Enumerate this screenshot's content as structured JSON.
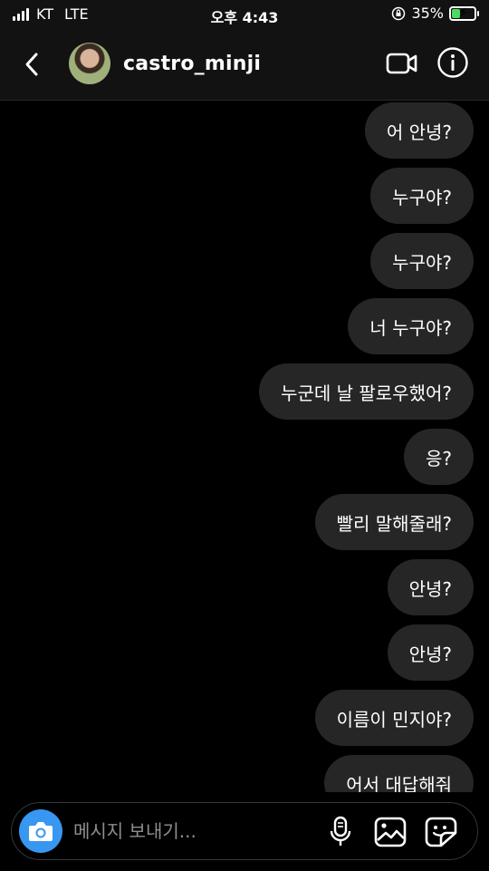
{
  "status_bar": {
    "carrier": "KT",
    "network": "LTE",
    "time": "오후 4:43",
    "battery_percent": "35%",
    "battery_level": 0.35,
    "battery_color": "#4cd964"
  },
  "header": {
    "username": "castro_minji",
    "back_icon": "chevron-left-icon",
    "video_icon": "video-camera-icon",
    "info_icon": "info-icon"
  },
  "messages": [
    {
      "text": "어 안녕?"
    },
    {
      "text": "누구야?"
    },
    {
      "text": "누구야?"
    },
    {
      "text": "너 누구야?"
    },
    {
      "text": "누군데 날 팔로우했어?"
    },
    {
      "text": "응?"
    },
    {
      "text": "빨리 말해줄래?"
    },
    {
      "text": "안녕?"
    },
    {
      "text": "안녕?"
    },
    {
      "text": "이름이 민지야?"
    },
    {
      "text": "어서 대답해줘"
    }
  ],
  "composer": {
    "placeholder": "메시지 보내기...",
    "value": "",
    "accent_color": "#3897f0"
  }
}
